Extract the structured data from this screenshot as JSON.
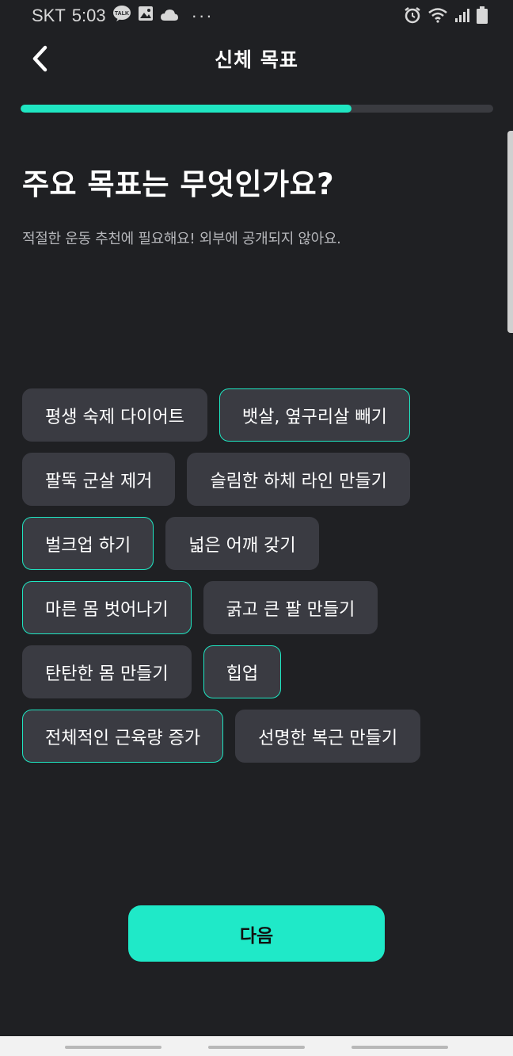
{
  "status_bar": {
    "carrier": "SKT",
    "time": "5:03",
    "icons_left": [
      "kakaotalk-icon",
      "image-icon",
      "cloud-icon",
      "more-dots-icon"
    ],
    "icons_right": [
      "alarm-icon",
      "wifi-icon",
      "signal-icon",
      "battery-icon"
    ],
    "talk_text": "TALK",
    "dots": "···"
  },
  "header": {
    "title": "신체 목표",
    "back_icon": "chevron-left-icon"
  },
  "progress": {
    "fraction": 0.7,
    "accent_color": "#1fe6c2"
  },
  "question": {
    "title": "주요 목표는 무엇인가요?",
    "subtitle": "적절한 운동 추천에 필요해요! 외부에 공개되지 않아요."
  },
  "goals": {
    "rows": [
      [
        {
          "label": "평생 숙제 다이어트",
          "selected": false
        },
        {
          "label": "뱃살, 옆구리살 빼기",
          "selected": true
        }
      ],
      [
        {
          "label": "팔뚝 군살 제거",
          "selected": false
        },
        {
          "label": "슬림한 하체 라인 만들기",
          "selected": false
        }
      ],
      [
        {
          "label": "벌크업 하기",
          "selected": true
        },
        {
          "label": "넓은 어깨 갖기",
          "selected": false
        }
      ],
      [
        {
          "label": "마른 몸 벗어나기",
          "selected": true
        },
        {
          "label": "굵고 큰 팔 만들기",
          "selected": false
        }
      ],
      [
        {
          "label": "탄탄한 몸 만들기",
          "selected": false
        },
        {
          "label": "힙업",
          "selected": true
        }
      ],
      [
        {
          "label": "전체적인 근육량 증가",
          "selected": true
        },
        {
          "label": "선명한 복근 만들기",
          "selected": false
        }
      ]
    ]
  },
  "next_button": {
    "label": "다음"
  },
  "colors": {
    "background": "#1f2023",
    "chip_bg": "#3a3b42",
    "accent": "#1fe6c2",
    "button": "#1fe9c8"
  }
}
